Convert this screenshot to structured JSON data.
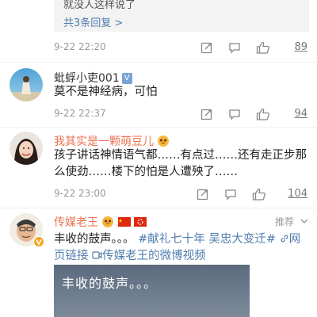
{
  "top_reply": {
    "snippet": "就没人这样说了",
    "more_label": "共3条回复 >"
  },
  "first_actions": {
    "time": "9-22 22:20",
    "like_count": "89"
  },
  "comments": [
    {
      "username": "蚍蜉小吏001",
      "badge": "V",
      "text": "莫不是神经病，可怕",
      "time": "9-22 22:37",
      "like_count": "94"
    },
    {
      "username": "我其实是一颗萌豆儿",
      "text": "孩子讲话神情语气都……有点过……还有走正步那么使劲……楼下的怕是人遭殃了……",
      "time": "9-22 23:00",
      "like_count": "104"
    },
    {
      "username": "传媒老王",
      "badge_label": "推荐",
      "text_plain": "丰收的鼓声。。。",
      "hashtag1": "#献礼七十年",
      "hashtag2": "吴忠大变迁#",
      "link1": "网页链接",
      "link2": "传媒老王的微博视频",
      "video_caption": "丰收的鼓声。。。"
    }
  ],
  "colors": {
    "link": "#507daf",
    "name_orange": "#eb7350",
    "like_underline": "#777777"
  }
}
